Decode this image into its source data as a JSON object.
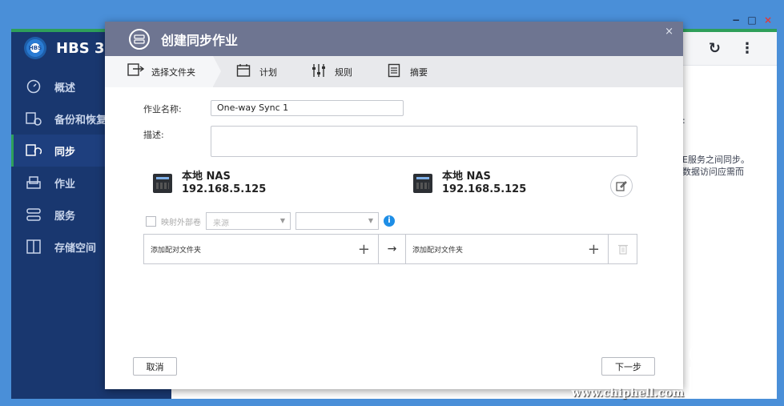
{
  "window_controls": {
    "minimize": "−",
    "maximize": "□",
    "close": "×"
  },
  "app": {
    "name": "HBS 3",
    "logo_text": "HBS",
    "refresh_icon": "refresh-icon",
    "more_icon": "more-vertical-icon",
    "sidebar": [
      {
        "label": "概述",
        "icon": "gauge-icon",
        "active": false
      },
      {
        "label": "备份和恢复",
        "icon": "backup-restore-icon",
        "active": false
      },
      {
        "label": "同步",
        "icon": "sync-icon",
        "active": true
      },
      {
        "label": "作业",
        "icon": "jobs-icon",
        "active": false
      },
      {
        "label": "服务",
        "icon": "services-icon",
        "active": false
      },
      {
        "label": "存储空间",
        "icon": "storage-icon",
        "active": false
      }
    ],
    "bg_text_line1": "E服务之间同步。",
    "bg_text_line2": "数据访问应需而",
    "bg_dot": ":"
  },
  "dialog": {
    "title": "创建同步作业",
    "close": "×",
    "steps": [
      {
        "label": "选择文件夹",
        "icon": "folder-select-icon"
      },
      {
        "label": "计划",
        "icon": "calendar-icon"
      },
      {
        "label": "规则",
        "icon": "rules-icon"
      },
      {
        "label": "摘要",
        "icon": "summary-icon"
      }
    ],
    "form": {
      "job_name_label": "作业名称:",
      "job_name_value": "One-way Sync 1",
      "description_label": "描述:",
      "description_value": ""
    },
    "source": {
      "name": "本地 NAS",
      "ip": "192.168.5.125"
    },
    "destination": {
      "name": "本地 NAS",
      "ip": "192.168.5.125"
    },
    "mapping": {
      "label": "映射外部卷",
      "source_placeholder": "来源",
      "dest_placeholder": ""
    },
    "pair": {
      "source_label": "添加配对文件夹",
      "dest_label": "添加配对文件夹",
      "plus": "+",
      "arrow": "→"
    },
    "buttons": {
      "cancel": "取消",
      "next": "下一步"
    }
  },
  "watermark": {
    "url": "www.chiphell.com",
    "logo_line1": "chip",
    "logo_line2": "hell"
  }
}
